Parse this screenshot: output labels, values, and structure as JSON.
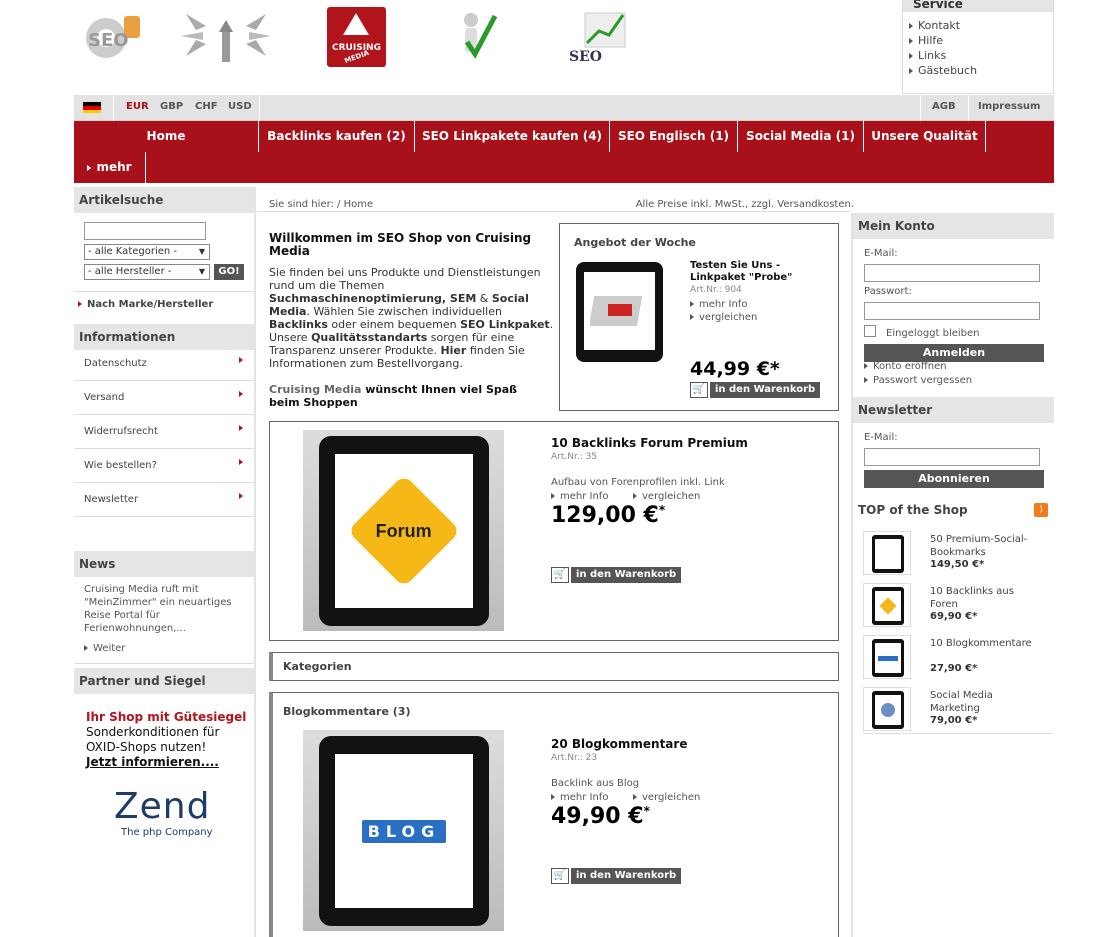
{
  "header": {
    "logo_cruising": "CRUISING",
    "logo_media": "MEDIA",
    "logo_seo": "SEO",
    "service": {
      "title": "Service",
      "items": [
        "Kontakt",
        "Hilfe",
        "Links",
        "Gästebuch"
      ]
    }
  },
  "topbar": {
    "currencies": [
      "EUR",
      "GBP",
      "CHF",
      "USD"
    ],
    "active_currency": "EUR",
    "agb": "AGB",
    "impressum": "Impressum"
  },
  "nav": {
    "items": [
      "Home",
      "Backlinks kaufen (2)",
      "SEO Linkpakete kaufen (4)",
      "SEO Englisch (1)",
      "Social Media (1)",
      "Unsere Qualität"
    ],
    "more": "mehr"
  },
  "left": {
    "search_title": "Artikelsuche",
    "search_value": "",
    "category_select": "- alle Kategorien -",
    "manufacturer_select": "- alle Hersteller -",
    "go_label": "GO!",
    "brand_link": "Nach Marke/Hersteller",
    "info_title": "Informationen",
    "info_items": [
      "Datenschutz",
      "Versand",
      "Widerrufsrecht",
      "Wie bestellen?",
      "Newsletter"
    ],
    "news_title": "News",
    "news_text": "Cruising Media ruft mit \"MeinZimmer\" ein neuartiges Reise Portal für Ferienwohnungen,...",
    "news_more": "Weiter",
    "partner_title": "Partner und Siegel",
    "partner_red": "Ihr Shop mit Gütesiegel",
    "partner_text": "Sonderkonditionen für OXID-Shops nutzen!",
    "partner_link": "Jetzt informieren....",
    "zend_logo": "Zend",
    "zend_tag": "The php Company"
  },
  "main": {
    "breadcrumb": "Sie sind hier: / Home",
    "price_note": "Alle Preise inkl. MwSt., zzgl. Versandkosten.",
    "welcome_title": "Willkommen im SEO Shop von Cruising Media",
    "welcome_p1a": "Sie finden bei uns Produkte und Dienstleistungen rund um die Themen ",
    "welcome_p1b": "Suchmaschinenoptimierung, SEM",
    "welcome_p1c": " & ",
    "welcome_p1d": "Social Media",
    "welcome_p1e": ". Wählen Sie zwischen individuellen ",
    "welcome_p1f": "Backlinks",
    "welcome_p1g": " oder einem bequemen ",
    "welcome_p1h": "SEO Linkpaket",
    "welcome_p1i": ". Unsere ",
    "welcome_p1j": "Qualitätsstandarts",
    "welcome_p1k": " sorgen für eine Transparenz unserer Produkte. ",
    "welcome_p1l": "Hier",
    "welcome_p1m": " finden Sie Informationen zum Bestellvorgang.",
    "welcome_p2a": "Cruising Media",
    "welcome_p2b": " wünscht Ihnen viel Spaß beim Shoppen",
    "offer": {
      "title": "Angebot der Woche",
      "name": "Testen Sie Uns - Linkpaket \"Probe\"",
      "artnr": "Art.Nr.: 904",
      "more": "mehr Info",
      "compare": "vergleichen",
      "price": "44,99 €*",
      "cart": "in den Warenkorb"
    },
    "product1": {
      "name": "10 Backlinks Forum Premium",
      "artnr": "Art.Nr.: 35",
      "desc": "Aufbau von Forenprofilen inkl. Link",
      "more": "mehr Info",
      "compare": "vergleichen",
      "price": "129,00 €",
      "star": "*",
      "cart": "in den Warenkorb",
      "image_text": "Forum"
    },
    "categories_title": "Kategorien",
    "blog_section": "Blogkommentare (3)",
    "product2": {
      "name": "20 Blogkommentare",
      "artnr": "Art.Nr.: 23",
      "desc": "Backlink aus Blog",
      "more": "mehr Info",
      "compare": "vergleichen",
      "price": "49,90 €",
      "star": "*",
      "cart": "in den Warenkorb",
      "image_text": "BLOG"
    }
  },
  "right": {
    "account_title": "Mein Konto",
    "email_label": "E-Mail:",
    "password_label": "Passwort:",
    "remember": "Eingeloggt bleiben",
    "login": "Anmelden",
    "open_account": "Konto eröffnen",
    "forgot": "Passwort vergessen",
    "newsletter_title": "Newsletter",
    "nl_email_label": "E-Mail:",
    "subscribe": "Abonnieren",
    "top_title": "TOP of the Shop",
    "top_items": [
      {
        "name": "50 Premium-Social-Bookmarks",
        "price": "149,50 €*"
      },
      {
        "name": "10 Backlinks aus Foren",
        "price": "69,90 €*"
      },
      {
        "name": "10 Blogkommentare",
        "price": "27,90 €*"
      },
      {
        "name": "Social Media Marketing",
        "price": "79,00 €*"
      }
    ]
  }
}
